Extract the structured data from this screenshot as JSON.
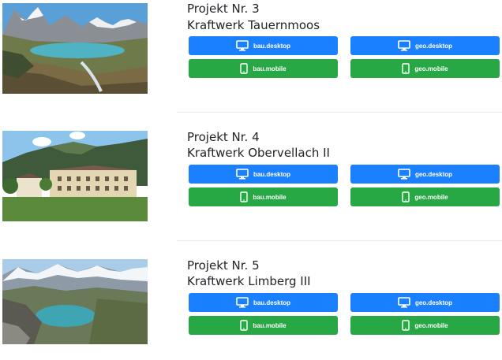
{
  "projects": [
    {
      "number_label": "Projekt Nr. 3",
      "name": "Kraftwerk Tauernmoos",
      "buttons": {
        "bau_desktop": "bau.desktop",
        "geo_desktop": "geo.desktop",
        "bau_mobile": "bau.mobile",
        "geo_mobile": "geo.mobile"
      }
    },
    {
      "number_label": "Projekt Nr. 4",
      "name": "Kraftwerk Obervellach II",
      "buttons": {
        "bau_desktop": "bau.desktop",
        "geo_desktop": "geo.desktop",
        "bau_mobile": "bau.mobile",
        "geo_mobile": "geo.mobile"
      }
    },
    {
      "number_label": "Projekt Nr. 5",
      "name": "Kraftwerk Limberg III",
      "buttons": {
        "bau_desktop": "bau.desktop",
        "geo_desktop": "geo.desktop",
        "bau_mobile": "bau.mobile",
        "geo_mobile": "geo.mobile"
      }
    }
  ],
  "icons": {
    "desktop": "desktop-monitor-icon",
    "mobile": "mobile-phone-icon"
  },
  "colors": {
    "desktop_button": "#1a80ff",
    "mobile_button": "#28a745"
  }
}
